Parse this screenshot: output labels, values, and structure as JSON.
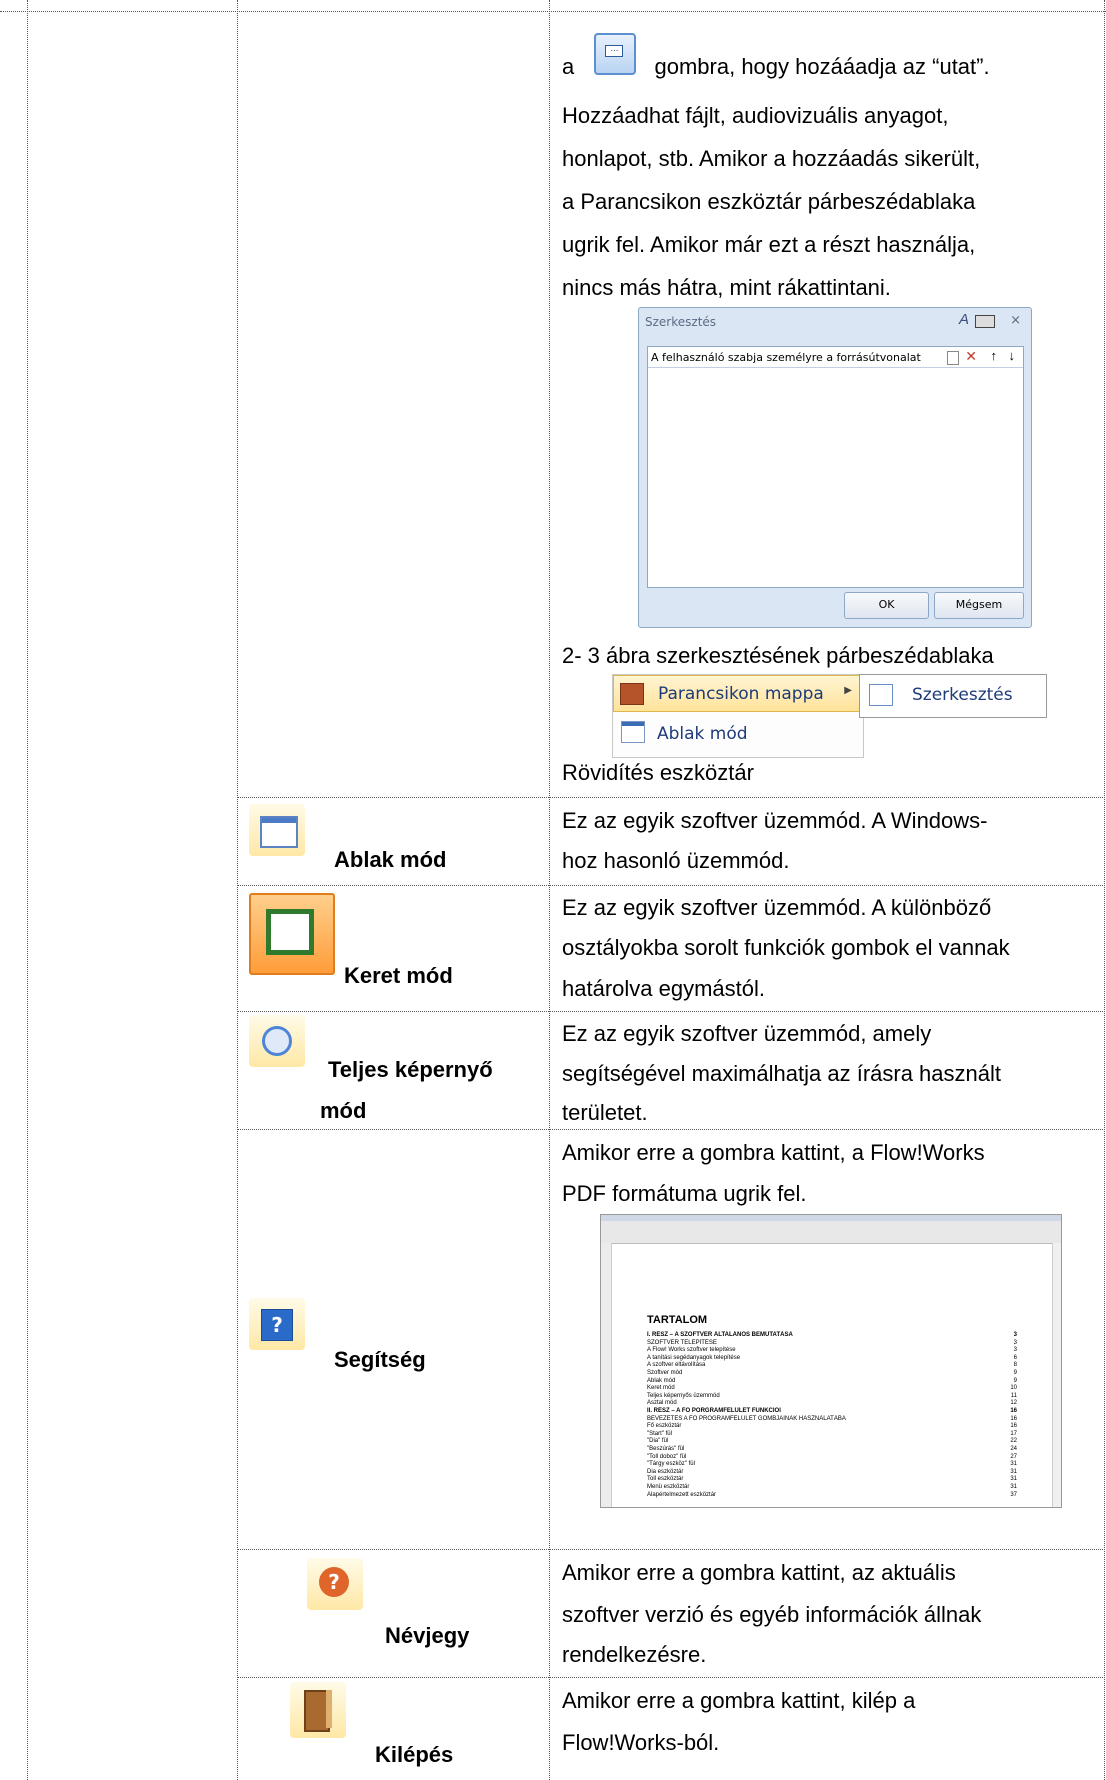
{
  "top": {
    "line1_pre": "a",
    "line1_post": "gombra, hogy hozááadja az “utat”.",
    "lines": [
      "Hozzáadhat fájlt, audiovizuális anyagot,",
      "honlapot, stb.    Amikor a hozzáadás sikerült,",
      "a Parancsikon eszköztár párbeszédablaka",
      "ugrik fel. Amikor már ezt a részt használja,",
      "nincs más hátra, mint rákattintani."
    ],
    "figure_caption": "2- 3 ábra szerkesztésének párbeszédablaka",
    "menu_caption": "Rövidítés eszköztár"
  },
  "dialog": {
    "title": "Szerkesztés",
    "header": "A felhasználó szabja személyre a forrásútvonalat",
    "ok": "OK",
    "cancel": "Mégsem"
  },
  "menu": {
    "item1": "Parancsikon mappa",
    "item2": "Ablak mód",
    "sub": "Szerkesztés"
  },
  "rows": [
    {
      "label": "Ablak mód",
      "desc": [
        "Ez az egyik szoftver üzemmód. A Windows-",
        "hoz hasonló üzemmód."
      ]
    },
    {
      "label": "Keret mód",
      "desc": [
        "Ez az egyik szoftver üzemmód. A különböző",
        "osztályokba sorolt funkciók gombok el vannak",
        "határolva egymástól."
      ]
    },
    {
      "label": "Teljes képernyő",
      "label2": "mód",
      "desc": [
        "Ez az egyik szoftver üzemmód, amely",
        "segítségével maximálhatja az írásra használt",
        "területet."
      ]
    },
    {
      "label": "Segítség",
      "desc": [
        "Amikor erre a gombra kattint, a Flow!Works",
        "PDF formátuma ugrik fel."
      ]
    },
    {
      "label": "Névjegy",
      "desc": [
        "Amikor erre a gombra kattint, az aktuális",
        "szoftver verzió és egyéb információk állnak",
        "rendelkezésre."
      ]
    },
    {
      "label": "Kilépés",
      "desc": [
        "Amikor erre a gombra kattint, kilép a",
        "Flow!Works-ból."
      ]
    }
  ],
  "pdf": {
    "heading": "TARTALOM",
    "toc": [
      "I. RÉSZ – A SZOFTVER ÁLTALÁNOS BEMUTATÁSA",
      "SZOFTVER TELEPÍTÉSE",
      "A Flow! Works szoftver telepítése",
      "A tanítási segédanyagok telepítése",
      "A szoftver eltávolítása",
      "Szoftver mód",
      "Ablak mód",
      "Keret mód",
      "Teljes képernyős üzemmód",
      "Asztal mód",
      "II. RÉSZ – A FŐ PORGRAMFELÜLET FUNKCIÓI",
      "BEVEZETÉS A FŐ PROGRAMFELÜLET GOMBJAINAK HASZNÁLATÁBA",
      "Fő eszköztár",
      "\"Start\" fül",
      "\"Dia\" fül",
      "\"Beszúrás\" fül",
      "\"Toll doboz\" fül",
      "\"Tárgy eszköz\" fül",
      "Dia eszköztár",
      "Toll eszköztár",
      "Menü eszköztár",
      "Alapértelmezett eszköztár"
    ],
    "pages": [
      "3",
      "3",
      "3",
      "6",
      "8",
      "9",
      "9",
      "10",
      "11",
      "12",
      "16",
      "16",
      "16",
      "17",
      "22",
      "24",
      "27",
      "31",
      "31",
      "31",
      "31",
      "37"
    ]
  },
  "colors": {
    "accent": "#2a5fb5",
    "border": "#555555"
  }
}
